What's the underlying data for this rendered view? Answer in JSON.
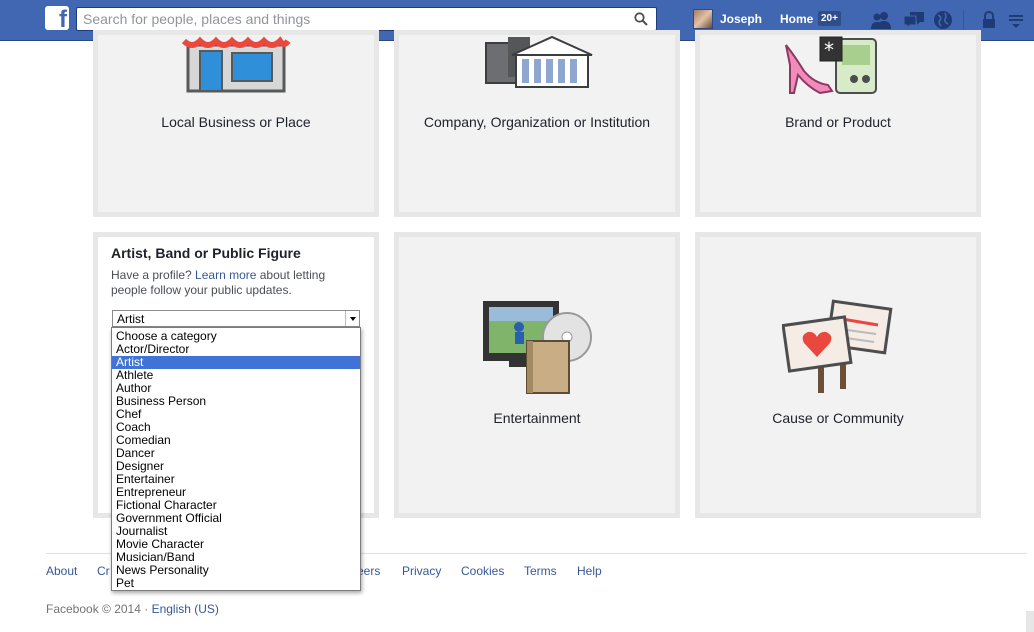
{
  "header": {
    "search_placeholder": "Search for people, places and things",
    "user_name": "Joseph",
    "home_label": "Home",
    "home_badge": "20+"
  },
  "tiles": {
    "local_business": "Local Business or Place",
    "company": "Company, Organization or Institution",
    "brand": "Brand or Product",
    "artist_title": "Artist, Band or Public Figure",
    "artist_desc_pre": "Have a profile? ",
    "artist_desc_link": "Learn more",
    "artist_desc_post": " about letting people follow your public updates.",
    "entertainment": "Entertainment",
    "cause": "Cause or Community"
  },
  "category_select": {
    "selected": "Artist",
    "options": [
      "Choose a category",
      "Actor/Director",
      "Artist",
      "Athlete",
      "Author",
      "Business Person",
      "Chef",
      "Coach",
      "Comedian",
      "Dancer",
      "Designer",
      "Entertainer",
      "Entrepreneur",
      "Fictional Character",
      "Government Official",
      "Journalist",
      "Movie Character",
      "Musician/Band",
      "News Personality",
      "Pet"
    ]
  },
  "footer": {
    "links": [
      "About",
      "Cr",
      "eers",
      "Privacy",
      "Cookies",
      "Terms",
      "Help"
    ],
    "copyright": "Facebook © 2014 · ",
    "language": "English (US)"
  },
  "colors": {
    "brand_blue": "#4267b2",
    "link_blue": "#365899",
    "selected_blue": "#3f74d6"
  }
}
